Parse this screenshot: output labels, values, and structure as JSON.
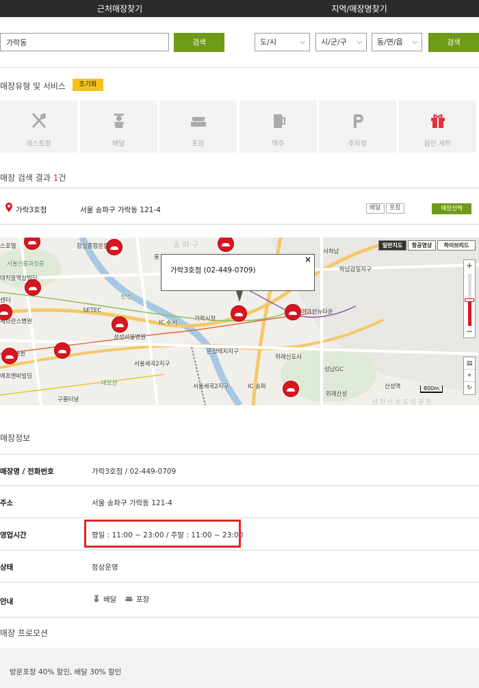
{
  "top_tabs": [
    "근처매장찾기",
    "지역/매장명찾기"
  ],
  "search": {
    "value": "가락동",
    "button": "검색",
    "selects": [
      "도/시",
      "시/군/구",
      "동/면/읍"
    ],
    "region_button": "검색"
  },
  "services": {
    "title": "매장유형 및 서비스",
    "reset": "초기화",
    "items": [
      {
        "label": "레스토랑",
        "icon": "fork-knife-icon"
      },
      {
        "label": "배달",
        "icon": "delivery-person-icon"
      },
      {
        "label": "포장",
        "icon": "takeout-box-icon"
      },
      {
        "label": "맥주",
        "icon": "beer-mug-icon"
      },
      {
        "label": "주차장",
        "icon": "parking-icon"
      },
      {
        "label": "옵인 세트",
        "icon": "gift-icon"
      }
    ]
  },
  "results": {
    "title_prefix": "매장 검색 결과 ",
    "count": "1",
    "title_suffix": "건",
    "store": {
      "name": "가락3호점",
      "address": "서울 송파구 가락동 121-4",
      "tags": [
        "배달",
        "포장"
      ],
      "select_button": "매장선택"
    }
  },
  "map": {
    "infowindow": "가락3호점 (02-449-0709)",
    "close": "×",
    "map_types": [
      "일반지도",
      "항공영상",
      "하이브리드"
    ],
    "zoom_in": "+",
    "zoom_out": "−",
    "scale": "800m",
    "labels": [
      "스포텔",
      "잠실종합운동",
      "송 파 구",
      "서하남",
      "서울선릉과정릉",
      "롯",
      "하남감일지구",
      "대치을역삼빌딩",
      "센터",
      "탄천",
      "SETEC",
      "가락시장",
      "대여마천뉴타운",
      "세브란스병원",
      "IC 수서",
      "삼성서울병원",
      "문정택지지구",
      "위례신도시",
      "기술원",
      "성남GC",
      "에프앤비빌딩",
      "서울세곡2지구",
      "대모산",
      "서울세곡2지구",
      "IC 송파",
      "산성역",
      "위례산성",
      "구룡터널",
      "남 한 산 성 도 립 공 원"
    ]
  },
  "info": {
    "title": "매장정보",
    "rows": [
      {
        "key": "매장명 / 전화번호",
        "value": "가락3호점 / 02-449-0709"
      },
      {
        "key": "주소",
        "value": "서울 송파구 가락동 121-4"
      },
      {
        "key": "영업시간",
        "value": "평일 : 11:00 ~ 23:00 / 주말 : 11:00 ~ 23:00"
      },
      {
        "key": "상태",
        "value": "정상운영"
      },
      {
        "key": "안내",
        "guide": [
          "배달",
          "포장"
        ]
      }
    ]
  },
  "promotion": {
    "title": "매장 프로모션",
    "text": "방문포장 40% 할인, 배달 30% 할인"
  },
  "colors": {
    "accent_green": "#6f9b16",
    "highlight_red": "#e0242a",
    "reset_yellow": "#f3c31b",
    "marker_red": "#d9151f"
  }
}
